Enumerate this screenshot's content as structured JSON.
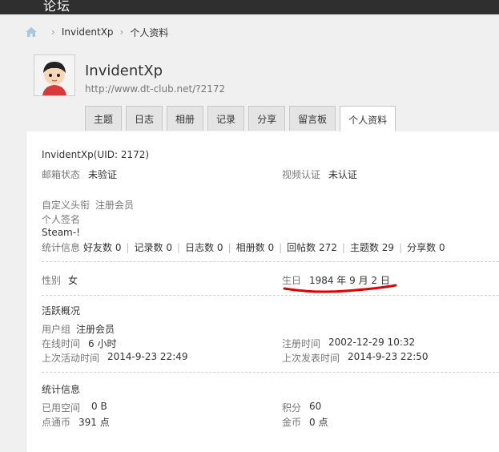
{
  "topbar": {
    "nav_label": "论坛"
  },
  "breadcrumb": {
    "user": "InvidentXp",
    "page": "个人资料"
  },
  "profile": {
    "name": "InvidentXp",
    "url": "http://www.dt-club.net/?2172"
  },
  "tabs": [
    {
      "label": "主题"
    },
    {
      "label": "日志"
    },
    {
      "label": "相册"
    },
    {
      "label": "记录"
    },
    {
      "label": "分享"
    },
    {
      "label": "留言板"
    },
    {
      "label": "个人资料"
    }
  ],
  "info": {
    "uid_line": "InvidentXp(UID: 2172)",
    "email_label": "邮箱状态",
    "email_value": "未验证",
    "video_label": "视频认证",
    "video_value": "未认证",
    "title_label": "自定义头衔",
    "title_value": "注册会员",
    "signature_label": "个人签名",
    "signature_value": "Steam-!",
    "stats_label": "统计信息",
    "stats": [
      {
        "label": "好友数",
        "value": "0"
      },
      {
        "label": "记录数",
        "value": "0"
      },
      {
        "label": "日志数",
        "value": "0"
      },
      {
        "label": "相册数",
        "value": "0"
      },
      {
        "label": "回帖数",
        "value": "272"
      },
      {
        "label": "主题数",
        "value": "29"
      },
      {
        "label": "分享数",
        "value": "0"
      }
    ]
  },
  "basic": {
    "gender_label": "性别",
    "gender_value": "女",
    "birthday_label": "生日",
    "birthday_value": "1984 年 9 月 2 日"
  },
  "activity": {
    "heading": "活跃概况",
    "group_label": "用户组",
    "group_value": "注册会员",
    "online_label": "在线时间",
    "online_value": "6 小时",
    "reg_label": "注册时间",
    "reg_value": "2002-12-29 10:32",
    "last_active_label": "上次活动时间",
    "last_active_value": "2014-9-23 22:49",
    "last_post_label": "上次发表时间",
    "last_post_value": "2014-9-23 22:50"
  },
  "statistics": {
    "heading": "统计信息",
    "space_label": "已用空间",
    "space_value": "0 B",
    "points_label": "积分",
    "points_value": "60",
    "coins_label": "点通币",
    "coins_value": "391 点",
    "gold_label": "金币",
    "gold_value": "0 点"
  }
}
